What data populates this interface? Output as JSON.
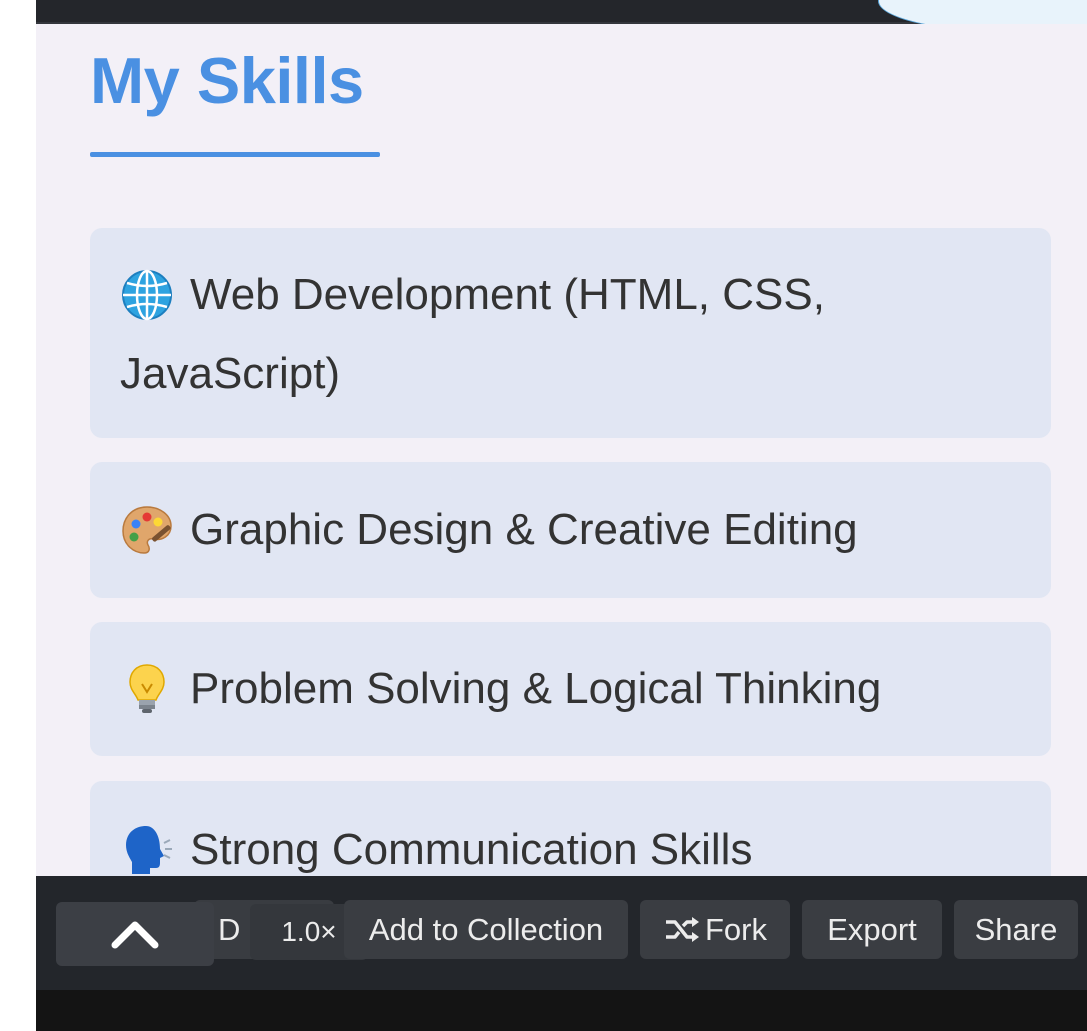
{
  "page": {
    "heading": "My Skills",
    "skills": [
      {
        "icon": "globe-icon",
        "label_line1": "Web Development (HTML, CSS,",
        "label_line2": "JavaScript)"
      },
      {
        "icon": "palette-icon",
        "label": "Graphic Design & Creative Editing"
      },
      {
        "icon": "light-bulb-icon",
        "label": "Problem Solving & Logical Thinking"
      },
      {
        "icon": "speaking-head-icon",
        "label": "Strong Communication Skills"
      }
    ]
  },
  "toolbar": {
    "up_icon": "chevron-up-icon",
    "ghost_label": "D",
    "speed_label": "1.0×",
    "add_to_collection_label": "Add to Collection",
    "fork_icon": "fork-icon",
    "fork_label": "Fork",
    "export_label": "Export",
    "share_label": "Share"
  },
  "colors": {
    "accent": "#4a90e2",
    "page_background": "#f3f0f7",
    "card_background": "#e1e6f3",
    "toolbar_background": "#23262b",
    "button_background": "#3a3d42"
  }
}
